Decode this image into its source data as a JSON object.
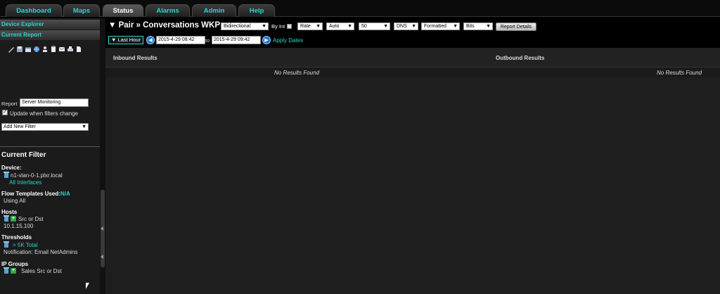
{
  "tabs": [
    {
      "label": "Dashboard",
      "active": false
    },
    {
      "label": "Maps",
      "active": false
    },
    {
      "label": "Status",
      "active": true
    },
    {
      "label": "Alarms",
      "active": false
    },
    {
      "label": "Admin",
      "active": false
    },
    {
      "label": "Help",
      "active": false
    }
  ],
  "sidebar": {
    "device_explorer": "Device Explorer",
    "current_report": "Current Report",
    "report_label": "Report",
    "report_value": "Server Monitoring",
    "update_label": "Update when filters change",
    "update_checked": true,
    "add_filter": "Add New Filter",
    "current_filter_title": "Current Filter",
    "device_head": "Device:",
    "device_name": "n1-vlan-0-1.plxr.local",
    "device_link": "All Interfaces",
    "flow_head": "Flow Templates Used:",
    "flow_value": "N/A",
    "flow_using": "Using All",
    "hosts_head": "Hosts",
    "hosts_dir": "Src or Dst",
    "hosts_ip": "10.1.15.100",
    "thresholds_head": "Thresholds",
    "thresholds_value": "> 5K Total",
    "thresholds_notify": "Notification: Email NetAdmins",
    "ipgroups_head": "IP Groups",
    "ipgroups_value": "Sales Src or Dst"
  },
  "toolbar": {
    "title": "▼ Pair » Conversations WKP",
    "direction": "Bidirectional",
    "by_int": "By Int",
    "rate": "Rate",
    "auto": "Auto",
    "count": "50",
    "dns": "DNS",
    "formatted": "Formatted",
    "bits": "Bits",
    "report_details": "Report Details"
  },
  "timebar": {
    "range": "▼ Last Hour",
    "start": "2015-4-29 08:42",
    "to": "to",
    "end": "2015-4-29 09:42",
    "apply": "Apply Dates"
  },
  "results": {
    "inbound": "Inbound Results",
    "outbound": "Outbound Results",
    "no_results": "No Results Found"
  },
  "colors": {
    "accent": "#28d7d0",
    "background": "#000000",
    "panel": "#1b1b1b"
  }
}
